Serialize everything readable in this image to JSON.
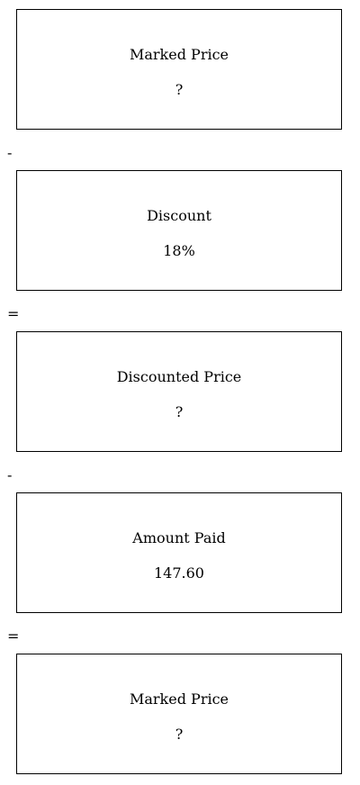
{
  "boxes": [
    {
      "label": "Marked Price",
      "value": "?"
    },
    {
      "label": "Discount",
      "value": "18%"
    },
    {
      "label": "Discounted Price",
      "value": "?"
    },
    {
      "label": "Amount Paid",
      "value": "147.60"
    },
    {
      "label": "Marked Price",
      "value": "?"
    }
  ],
  "operators": [
    "-",
    "=",
    "-",
    "="
  ]
}
